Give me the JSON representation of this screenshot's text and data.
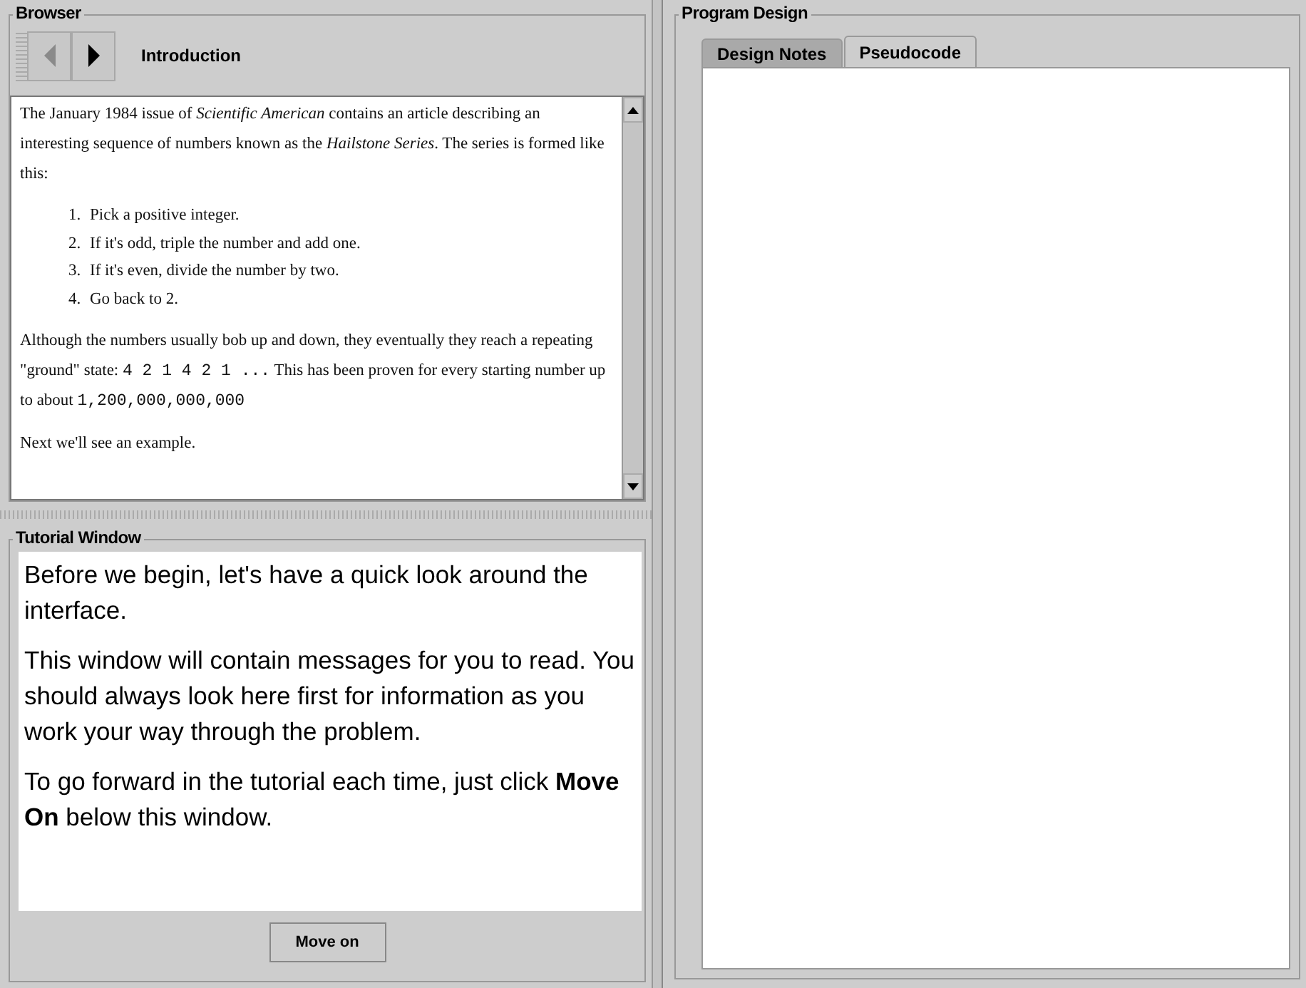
{
  "browser": {
    "title": "Browser",
    "nav": {
      "back_disabled": true,
      "forward_disabled": false
    },
    "page_title": "Introduction",
    "content": [
      {
        "kind": "para",
        "segments": [
          {
            "kind": "text",
            "text": "The January 1984 issue of *Scientific American* contains an article describing an interesting sequence of numbers known as the *Hailstone Series*. The series is formed like this:"
          }
        ]
      },
      {
        "kind": "list",
        "items": [
          "Pick a positive integer.",
          "If it's odd, triple the number and add one.",
          "If it's even, divide the number by two.",
          "Go back to 2."
        ],
        "numbers": [
          "1.",
          "2.",
          "3.",
          "4."
        ]
      },
      {
        "kind": "para",
        "segments": [
          {
            "kind": "text",
            "text": "Although the numbers usually bob up and down, they eventually they reach a repeating \"ground\" state: "
          },
          {
            "kind": "code",
            "text": "4 2 1 4 2 1 ..."
          },
          {
            "kind": "text",
            "text": " This has been proven for every starting number up to about "
          },
          {
            "kind": "code",
            "text": "1,200,000,000,000"
          }
        ]
      },
      {
        "kind": "para",
        "segments": [
          {
            "kind": "text",
            "text": "Next we'll see an example."
          }
        ]
      }
    ]
  },
  "tutorial": {
    "title": "Tutorial Window",
    "paragraphs": [
      "Before we begin, let's have a quick look around the interface.",
      "This window will contain messages for you to read. You should always look here first for information as you work your way through the problem.",
      "To go forward in the tutorial each time, just click **Move On** below this window."
    ],
    "button": "Move on"
  },
  "program_design": {
    "title": "Program Design",
    "tabs": [
      {
        "label": "Design Notes",
        "selected": false
      },
      {
        "label": "Pseudocode",
        "selected": true
      }
    ]
  }
}
